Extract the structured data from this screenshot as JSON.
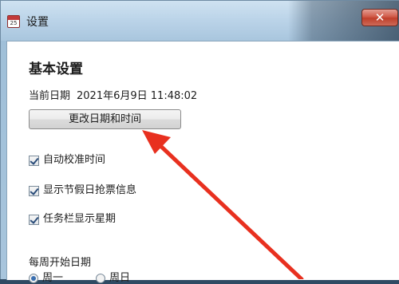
{
  "window": {
    "title": "设置",
    "icon_text": "25",
    "close_label": "✕"
  },
  "settings": {
    "section_title": "基本设置",
    "current_date_label": "当前日期",
    "current_date_value": "2021年6月9日 11:48:02",
    "change_button_label": "更改日期和时间",
    "checkboxes": [
      {
        "label": "自动校准时间",
        "checked": true
      },
      {
        "label": "显示节假日抢票信息",
        "checked": true
      },
      {
        "label": "任务栏显示星期",
        "checked": true
      }
    ],
    "week_start_label": "每周开始日期",
    "week_start_options": [
      {
        "label": "周一",
        "selected": true
      },
      {
        "label": "周日",
        "selected": false
      }
    ]
  },
  "annotation": {
    "arrow_color": "#e8301f"
  }
}
